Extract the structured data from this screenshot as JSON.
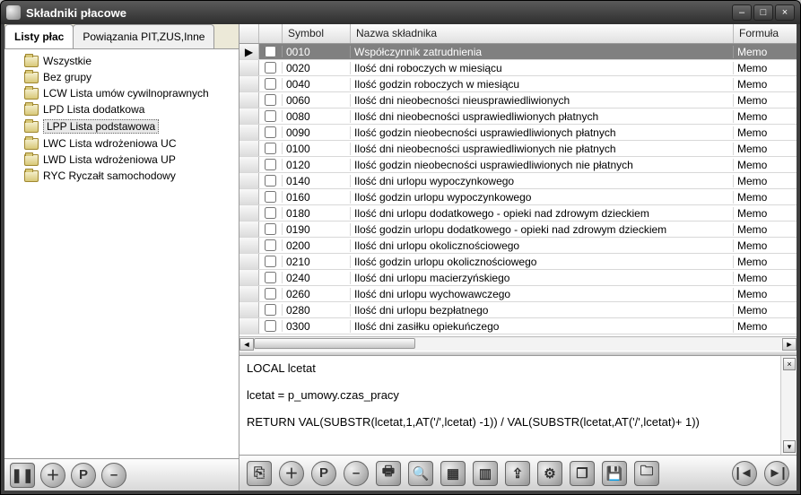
{
  "window": {
    "title": "Składniki płacowe"
  },
  "tabs": {
    "list": "Listy płac",
    "links": "Powiązania PIT,ZUS,Inne"
  },
  "tree": {
    "items": [
      {
        "label": "Wszystkie"
      },
      {
        "label": "Bez grupy"
      },
      {
        "label": "LCW Lista umów cywilnoprawnych"
      },
      {
        "label": "LPD Lista dodatkowa"
      },
      {
        "label": "LPP Lista podstawowa",
        "selected": true
      },
      {
        "label": "LWC Lista wdrożeniowa UC"
      },
      {
        "label": "LWD Lista wdrożeniowa UP"
      },
      {
        "label": "RYC Ryczałt samochodowy"
      }
    ]
  },
  "grid": {
    "headers": {
      "symbol": "Symbol",
      "name": "Nazwa składnika",
      "formula": "Formuła"
    },
    "rows": [
      {
        "symbol": "0010",
        "name": "Współczynnik zatrudnienia",
        "formula": "Memo",
        "selected": true
      },
      {
        "symbol": "0020",
        "name": "Ilość dni roboczych w miesiącu",
        "formula": "Memo"
      },
      {
        "symbol": "0040",
        "name": "Ilość godzin roboczych w miesiącu",
        "formula": "Memo"
      },
      {
        "symbol": "0060",
        "name": "Ilość dni nieobecności nieusprawiedliwionych",
        "formula": "Memo"
      },
      {
        "symbol": "0080",
        "name": "Ilość dni nieobecności usprawiedliwionych płatnych",
        "formula": "Memo"
      },
      {
        "symbol": "0090",
        "name": "Ilość godzin nieobecności usprawiedliwionych płatnych",
        "formula": "Memo"
      },
      {
        "symbol": "0100",
        "name": "Ilość dni nieobecności usprawiedliwionych nie płatnych",
        "formula": "Memo"
      },
      {
        "symbol": "0120",
        "name": "Ilość godzin nieobecności usprawiedliwionych nie płatnych",
        "formula": "Memo"
      },
      {
        "symbol": "0140",
        "name": "Ilość dni urlopu wypoczynkowego",
        "formula": "Memo"
      },
      {
        "symbol": "0160",
        "name": "Ilość godzin urlopu wypoczynkowego",
        "formula": "Memo"
      },
      {
        "symbol": "0180",
        "name": "Ilość dni urlopu dodatkowego - opieki nad zdrowym dzieckiem",
        "formula": "Memo"
      },
      {
        "symbol": "0190",
        "name": "Ilość godzin urlopu dodatkowego - opieki nad zdrowym dzieckiem",
        "formula": "Memo"
      },
      {
        "symbol": "0200",
        "name": "Ilość dni urlopu okolicznościowego",
        "formula": "Memo"
      },
      {
        "symbol": "0210",
        "name": "Ilość godzin urlopu okolicznościowego",
        "formula": "Memo"
      },
      {
        "symbol": "0240",
        "name": "Ilość dni urlopu macierzyńskiego",
        "formula": "Memo"
      },
      {
        "symbol": "0260",
        "name": "Ilość dni urlopu wychowawczego",
        "formula": "Memo"
      },
      {
        "symbol": "0280",
        "name": "Ilość dni urlopu bezpłatnego",
        "formula": "Memo"
      },
      {
        "symbol": "0300",
        "name": "Ilość dni zasiłku opiekuńczego",
        "formula": "Memo"
      }
    ]
  },
  "code": {
    "line1": "LOCAL lcetat",
    "line2": "lcetat = p_umowy.czas_pracy",
    "line3": "RETURN VAL(SUBSTR(lcetat,1,AT('/',lcetat) -1)) / VAL(SUBSTR(lcetat,AT('/',lcetat)+ 1))"
  }
}
